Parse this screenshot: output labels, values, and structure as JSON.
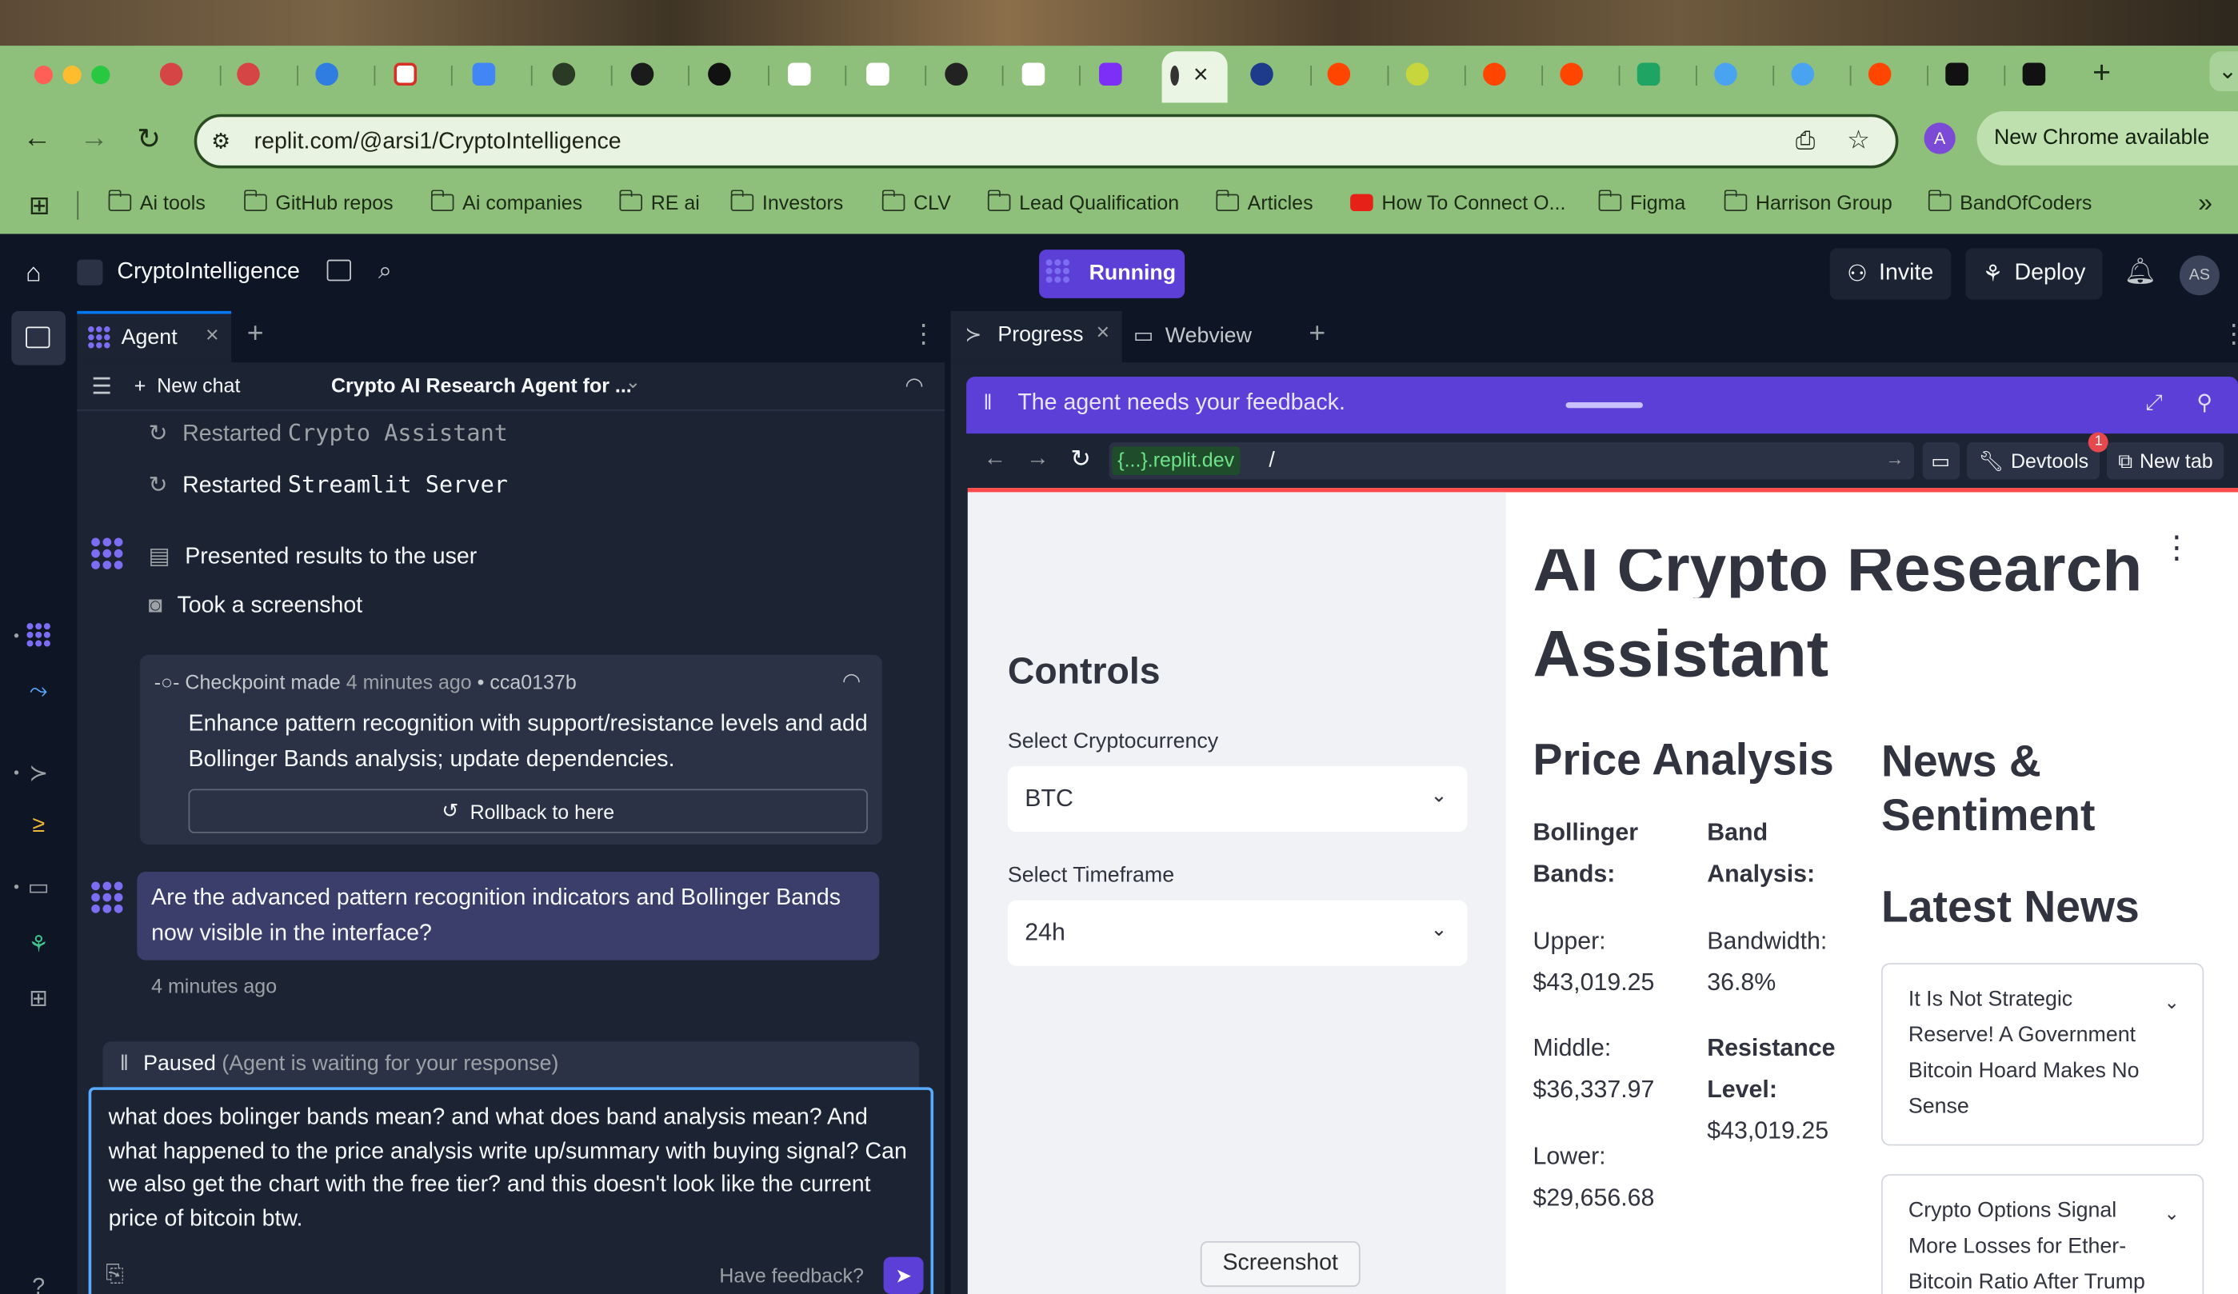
{
  "browser": {
    "url": "replit.com/@arsi1/CryptoIntelligence",
    "update_label": "New Chrome available",
    "bookmarks": [
      "Ai tools",
      "GitHub repos",
      "Ai companies",
      "RE ai",
      "Investors",
      "CLV",
      "Lead Qualification",
      "Articles",
      "How To Connect O...",
      "Figma",
      "Harrison Group",
      "BandOfCoders"
    ],
    "overflow": "»"
  },
  "header": {
    "project_name": "CryptoIntelligence",
    "run_status": "Running",
    "invite_label": "Invite",
    "deploy_label": "Deploy",
    "avatar_initials": "AS"
  },
  "agent": {
    "tab_label": "Agent",
    "new_chat_label": "New chat",
    "chat_title": "Crypto AI Research Agent for ...",
    "log": {
      "restart1_prefix": "Restarted",
      "restart1_name": "Crypto Assistant",
      "restart2_prefix": "Restarted",
      "restart2_name": "Streamlit Server",
      "presented": "Presented results to the user",
      "screenshot": "Took a screenshot"
    },
    "checkpoint": {
      "label": "Checkpoint made",
      "time": "4 minutes ago",
      "bullet": "•",
      "hash": "cca0137b",
      "description": "Enhance pattern recognition with support/resistance levels and add Bollinger Bands analysis; update dependencies.",
      "rollback_label": "Rollback to here"
    },
    "agent_question": "Are the advanced pattern recognition indicators and Bollinger Bands now visible in the interface?",
    "question_time": "4 minutes ago",
    "paused_label": "Paused",
    "paused_detail": "(Agent is waiting for your response)",
    "compose_text": "what does bolinger bands mean? and what does band analysis mean? And what happened to the price analysis write up/summary with buying signal? Can we also get the chart with the free tier? and this doesn't look like the current price of bitcoin btw.",
    "feedback_label": "Have feedback?"
  },
  "right": {
    "progress_tab": "Progress",
    "webview_tab": "Webview",
    "feedback_banner": "The agent needs your feedback.",
    "wv_domain": "{...}.replit.dev",
    "wv_path": "/",
    "devtools_label": "Devtools",
    "devtools_badge": "1",
    "newtab_label": "New tab"
  },
  "app": {
    "title_fragment": "AI Crypto Research",
    "title_line2": "Assistant",
    "sidebar_heading": "Controls",
    "crypto_label": "Select Cryptocurrency",
    "crypto_value": "BTC",
    "timeframe_label": "Select Timeframe",
    "timeframe_value": "24h",
    "price_heading": "Price Analysis",
    "bollinger_heading": "Bollinger Bands:",
    "band_heading": "Band Analysis:",
    "upper": "Upper: $43,019.25",
    "middle": "Middle: $36,337.97",
    "lower": "Lower: $29,656.68",
    "bandwidth": "Bandwidth: 36.8%",
    "resistance_label": "Resistance Level:",
    "resistance_value": "$43,019.25",
    "news_heading": "News & Sentiment",
    "latest_heading": "Latest News",
    "news": [
      "It Is Not Strategic Reserve! A Government Bitcoin Hoard Makes No Sense",
      "Crypto Options Signal More Losses for Ether-Bitcoin Ratio After Trump"
    ]
  },
  "tooltip": "Screenshot",
  "colors": {
    "accent": "#5b3fd6",
    "panel": "#1c2333",
    "bg": "#0e1525",
    "chrome_frame": "#8ec07c"
  }
}
